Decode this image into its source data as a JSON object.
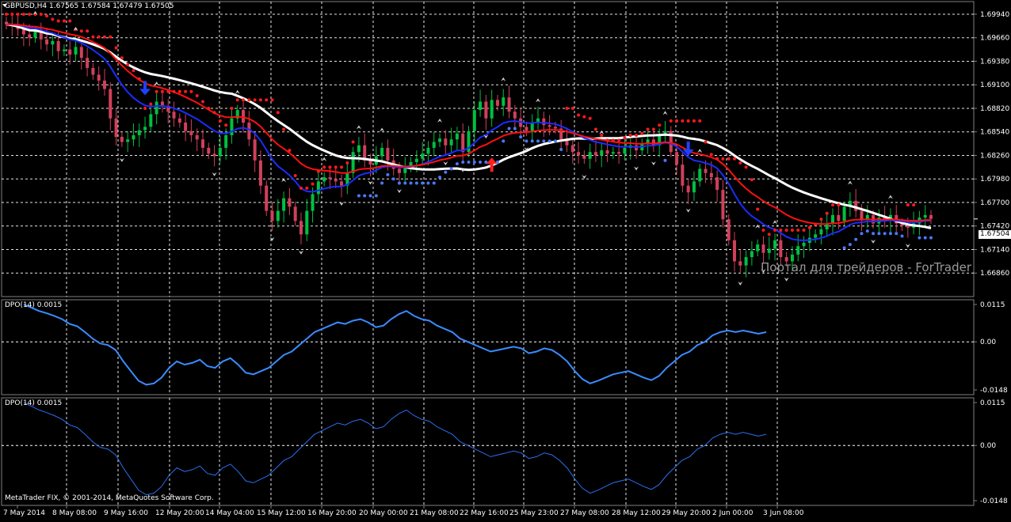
{
  "header": {
    "symbol": "GBPUSD,H4",
    "ohlc": "1.67565 1.67584 1.67479 1.67505"
  },
  "watermark": "Портал для трейдеров - ForTrader",
  "copyright": "MetaTrader FIX, © 2001-2014, MetaQuotes Software Corp.",
  "last_price": "1.67504",
  "colors": {
    "background": "#000000",
    "grid": "#ffffff",
    "bull_candle": "#00c040",
    "bear_candle": "#d0405a",
    "sma_slow": "#ffffff",
    "ema_blue": "#1a2dff",
    "ema_red": "#ff1010",
    "sar_red": "#ff1a1a",
    "sar_blue": "#4a78ff",
    "dpo_line1": "#3a8cff",
    "dpo_line2": "#2a6ff0",
    "arrow_up": "#ff2020",
    "arrow_down": "#2040ff"
  },
  "chart_data": [
    {
      "type": "candlestick",
      "symbol": "GBPUSD",
      "timeframe": "H4",
      "ylim": [
        1.6658,
        1.7009
      ],
      "y_ticks": [
        "1.69940",
        "1.69660",
        "1.69380",
        "1.69100",
        "1.68820",
        "1.68540",
        "1.68260",
        "1.67980",
        "1.67700",
        "1.67420",
        "1.67140",
        "1.66860"
      ],
      "x_ticks": [
        "7 May 2014",
        "8 May 08:00",
        "9 May 16:00",
        "12 May 20:00",
        "14 May 04:00",
        "15 May 12:00",
        "16 May 20:00",
        "20 May 00:00",
        "21 May 08:00",
        "22 May 16:00",
        "25 May 23:00",
        "27 May 08:00",
        "28 May 12:00",
        "29 May 20:00",
        "2 Jun 00:00",
        "3 Jun 08:00"
      ],
      "last_value": 1.67504,
      "close": [
        1.6982,
        1.698,
        1.6976,
        1.697,
        1.6966,
        1.6974,
        1.6964,
        1.6958,
        1.6962,
        1.695,
        1.6952,
        1.6946,
        1.6955,
        1.6942,
        1.693,
        1.6922,
        1.6915,
        1.6905,
        1.687,
        1.6848,
        1.6842,
        1.6845,
        1.685,
        1.6856,
        1.686,
        1.6875,
        1.689,
        1.6885,
        1.6878,
        1.687,
        1.6865,
        1.6855,
        1.685,
        1.6845,
        1.6835,
        1.6828,
        1.6825,
        1.6835,
        1.685,
        1.687,
        1.688,
        1.6865,
        1.6845,
        1.682,
        1.679,
        1.676,
        1.6748,
        1.676,
        1.6775,
        1.6765,
        1.6748,
        1.6732,
        1.676,
        1.678,
        1.6795,
        1.68,
        1.6798,
        1.6795,
        1.679,
        1.6805,
        1.683,
        1.6838,
        1.682,
        1.6815,
        1.6825,
        1.6835,
        1.682,
        1.681,
        1.6805,
        1.6812,
        1.6818,
        1.6822,
        1.6828,
        1.6835,
        1.6842,
        1.6846,
        1.6838,
        1.6845,
        1.6852,
        1.683,
        1.6855,
        1.688,
        1.689,
        1.687,
        1.6892,
        1.6885,
        1.6895,
        1.6878,
        1.687,
        1.686,
        1.6855,
        1.6865,
        1.687,
        1.6862,
        1.686,
        1.6858,
        1.6845,
        1.6838,
        1.683,
        1.6826,
        1.6822,
        1.683,
        1.6826,
        1.6832,
        1.6828,
        1.683,
        1.6828,
        1.6835,
        1.6838,
        1.6832,
        1.684,
        1.6845,
        1.6838,
        1.685,
        1.6855,
        1.683,
        1.6815,
        1.679,
        1.6782,
        1.6795,
        1.681,
        1.6805,
        1.68,
        1.6785,
        1.675,
        1.6725,
        1.67,
        1.6695,
        1.6705,
        1.6712,
        1.672,
        1.671,
        1.6715,
        1.6725,
        1.6705,
        1.67,
        1.6708,
        1.6718,
        1.6722,
        1.6728,
        1.6732,
        1.6738,
        1.6745,
        1.6755,
        1.6748,
        1.6765,
        1.6772,
        1.676,
        1.675,
        1.6755,
        1.6745,
        1.6752,
        1.6748,
        1.6755,
        1.6745,
        1.6742,
        1.674,
        1.6745,
        1.6752,
        1.6755,
        1.67505
      ]
    },
    {
      "type": "line",
      "title": "DPO(14) 0.0015",
      "ylim": [
        -0.0148,
        0.0115
      ],
      "y_ticks": [
        "0.0115",
        "0.00",
        "-0.0148"
      ],
      "values": [
        0.0115,
        0.0105,
        0.0095,
        0.0088,
        0.008,
        0.007,
        0.0055,
        0.0048,
        0.003,
        0.001,
        -0.0005,
        -0.001,
        -0.0025,
        -0.006,
        -0.009,
        -0.012,
        -0.0132,
        -0.0128,
        -0.011,
        -0.008,
        -0.006,
        -0.007,
        -0.0065,
        -0.0055,
        -0.0075,
        -0.008,
        -0.006,
        -0.005,
        -0.007,
        -0.0095,
        -0.01,
        -0.009,
        -0.008,
        -0.006,
        -0.004,
        -0.003,
        -0.001,
        0.001,
        0.003,
        0.004,
        0.005,
        0.006,
        0.0055,
        0.0065,
        0.007,
        0.006,
        0.0045,
        0.005,
        0.007,
        0.0085,
        0.0095,
        0.008,
        0.007,
        0.0065,
        0.005,
        0.004,
        0.003,
        0.001,
        0.0,
        -0.001,
        -0.002,
        -0.003,
        -0.0025,
        -0.002,
        -0.0015,
        -0.002,
        -0.0035,
        -0.003,
        -0.002,
        -0.0025,
        -0.004,
        -0.006,
        -0.009,
        -0.0115,
        -0.0128,
        -0.012,
        -0.011,
        -0.01,
        -0.0095,
        -0.009,
        -0.01,
        -0.011,
        -0.0118,
        -0.0105,
        -0.008,
        -0.006,
        -0.004,
        -0.003,
        -0.001,
        0.0,
        0.002,
        0.003,
        0.0035,
        0.003,
        0.0035,
        0.003,
        0.0025,
        0.003
      ]
    },
    {
      "type": "line",
      "title": "DPO(14) 0.0015",
      "ylim": [
        -0.0148,
        0.0115
      ],
      "y_ticks": [
        "0.0115",
        "0.00",
        "-0.0148"
      ],
      "values": "same as previous indicator"
    }
  ],
  "indicator1_label": "DPO(14) 0.0015",
  "indicator2_label": "DPO(14) 0.0015"
}
